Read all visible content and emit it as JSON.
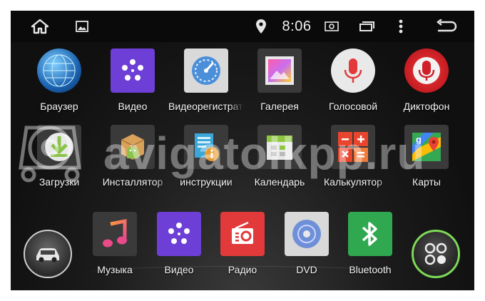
{
  "status_bar": {
    "time": "8:06",
    "icons": [
      "home-icon",
      "gallery-icon",
      "location-icon",
      "screenshot-icon",
      "recent-apps-icon",
      "more-icon",
      "back-icon"
    ]
  },
  "apps_row1": [
    {
      "label": "Браузер",
      "icon": "globe-icon",
      "color": "#1d6fb8"
    },
    {
      "label": "Видео",
      "icon": "video-dots-icon",
      "color": "#6d3fd6"
    },
    {
      "label": "Видеорегистратор",
      "icon": "gauge-icon",
      "color": "#4b8fd9"
    },
    {
      "label": "Галерея",
      "icon": "gallery-frame-icon",
      "color": "#d46ad6"
    },
    {
      "label": "Голосовой",
      "icon": "microphone-icon",
      "color": "#e23a3a"
    },
    {
      "label": "Диктофон",
      "icon": "recorder-mic-icon",
      "color": "#d11f2a"
    }
  ],
  "apps_row2": [
    {
      "label": "Загрузки",
      "icon": "download-icon",
      "color": "#8bc34a"
    },
    {
      "label": "Инсталлятор",
      "icon": "android-box-icon",
      "color": "#d8a25a"
    },
    {
      "label": "инструкции",
      "icon": "info-doc-icon",
      "color": "#3ba7d8"
    },
    {
      "label": "Календарь",
      "icon": "calendar-icon",
      "color": "#8cc63f"
    },
    {
      "label": "Калькулятор",
      "icon": "calculator-icon",
      "color": "#e8452c"
    },
    {
      "label": "Карты",
      "icon": "maps-icon",
      "color": "#34a853"
    }
  ],
  "dock": [
    {
      "label": "Музыка",
      "icon": "music-note-icon",
      "color": "#e84a8a"
    },
    {
      "label": "Видео",
      "icon": "video-dots-icon",
      "color": "#6d3fd6"
    },
    {
      "label": "Радио",
      "icon": "radio-icon",
      "color": "#e23a3a"
    },
    {
      "label": "DVD",
      "icon": "disc-icon",
      "color": "#6f8fd8"
    },
    {
      "label": "Bluetooth",
      "icon": "bluetooth-icon",
      "color": "#2fa84f"
    }
  ],
  "car_button": {
    "icon": "car-icon"
  },
  "apps_button": {
    "icon": "app-drawer-icon",
    "accent": "#7ed957"
  },
  "watermark_text": "avigatolkpp.ru"
}
